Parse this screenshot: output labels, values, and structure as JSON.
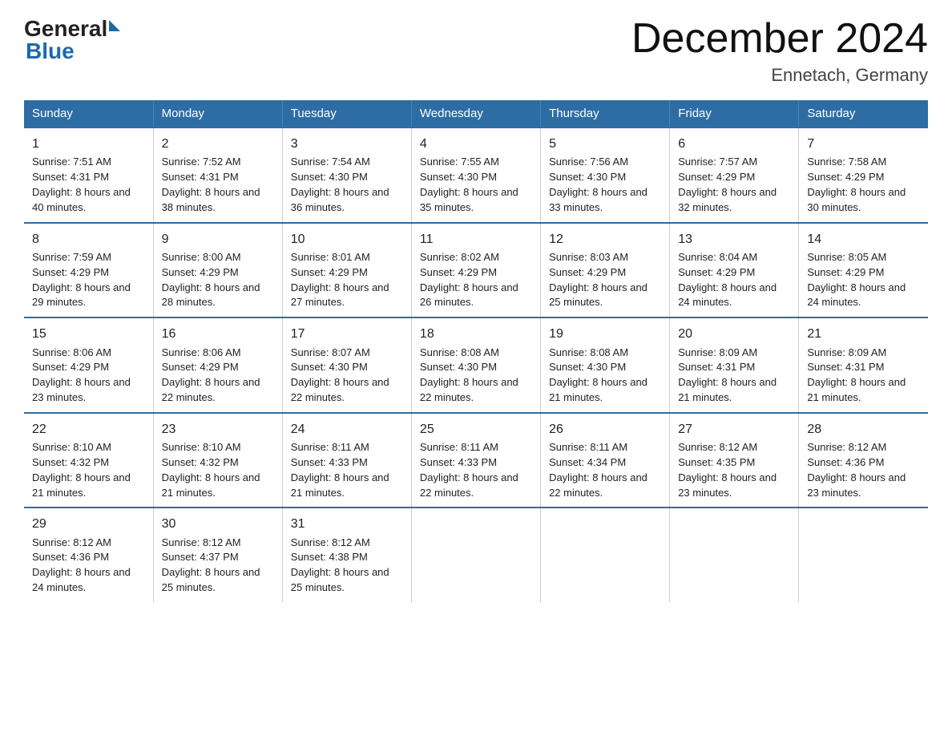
{
  "header": {
    "logo_general": "General",
    "logo_blue": "Blue",
    "title": "December 2024",
    "subtitle": "Ennetach, Germany"
  },
  "days_of_week": [
    "Sunday",
    "Monday",
    "Tuesday",
    "Wednesday",
    "Thursday",
    "Friday",
    "Saturday"
  ],
  "weeks": [
    [
      {
        "day": 1,
        "sunrise": "7:51 AM",
        "sunset": "4:31 PM",
        "daylight": "8 hours and 40 minutes."
      },
      {
        "day": 2,
        "sunrise": "7:52 AM",
        "sunset": "4:31 PM",
        "daylight": "8 hours and 38 minutes."
      },
      {
        "day": 3,
        "sunrise": "7:54 AM",
        "sunset": "4:30 PM",
        "daylight": "8 hours and 36 minutes."
      },
      {
        "day": 4,
        "sunrise": "7:55 AM",
        "sunset": "4:30 PM",
        "daylight": "8 hours and 35 minutes."
      },
      {
        "day": 5,
        "sunrise": "7:56 AM",
        "sunset": "4:30 PM",
        "daylight": "8 hours and 33 minutes."
      },
      {
        "day": 6,
        "sunrise": "7:57 AM",
        "sunset": "4:29 PM",
        "daylight": "8 hours and 32 minutes."
      },
      {
        "day": 7,
        "sunrise": "7:58 AM",
        "sunset": "4:29 PM",
        "daylight": "8 hours and 30 minutes."
      }
    ],
    [
      {
        "day": 8,
        "sunrise": "7:59 AM",
        "sunset": "4:29 PM",
        "daylight": "8 hours and 29 minutes."
      },
      {
        "day": 9,
        "sunrise": "8:00 AM",
        "sunset": "4:29 PM",
        "daylight": "8 hours and 28 minutes."
      },
      {
        "day": 10,
        "sunrise": "8:01 AM",
        "sunset": "4:29 PM",
        "daylight": "8 hours and 27 minutes."
      },
      {
        "day": 11,
        "sunrise": "8:02 AM",
        "sunset": "4:29 PM",
        "daylight": "8 hours and 26 minutes."
      },
      {
        "day": 12,
        "sunrise": "8:03 AM",
        "sunset": "4:29 PM",
        "daylight": "8 hours and 25 minutes."
      },
      {
        "day": 13,
        "sunrise": "8:04 AM",
        "sunset": "4:29 PM",
        "daylight": "8 hours and 24 minutes."
      },
      {
        "day": 14,
        "sunrise": "8:05 AM",
        "sunset": "4:29 PM",
        "daylight": "8 hours and 24 minutes."
      }
    ],
    [
      {
        "day": 15,
        "sunrise": "8:06 AM",
        "sunset": "4:29 PM",
        "daylight": "8 hours and 23 minutes."
      },
      {
        "day": 16,
        "sunrise": "8:06 AM",
        "sunset": "4:29 PM",
        "daylight": "8 hours and 22 minutes."
      },
      {
        "day": 17,
        "sunrise": "8:07 AM",
        "sunset": "4:30 PM",
        "daylight": "8 hours and 22 minutes."
      },
      {
        "day": 18,
        "sunrise": "8:08 AM",
        "sunset": "4:30 PM",
        "daylight": "8 hours and 22 minutes."
      },
      {
        "day": 19,
        "sunrise": "8:08 AM",
        "sunset": "4:30 PM",
        "daylight": "8 hours and 21 minutes."
      },
      {
        "day": 20,
        "sunrise": "8:09 AM",
        "sunset": "4:31 PM",
        "daylight": "8 hours and 21 minutes."
      },
      {
        "day": 21,
        "sunrise": "8:09 AM",
        "sunset": "4:31 PM",
        "daylight": "8 hours and 21 minutes."
      }
    ],
    [
      {
        "day": 22,
        "sunrise": "8:10 AM",
        "sunset": "4:32 PM",
        "daylight": "8 hours and 21 minutes."
      },
      {
        "day": 23,
        "sunrise": "8:10 AM",
        "sunset": "4:32 PM",
        "daylight": "8 hours and 21 minutes."
      },
      {
        "day": 24,
        "sunrise": "8:11 AM",
        "sunset": "4:33 PM",
        "daylight": "8 hours and 21 minutes."
      },
      {
        "day": 25,
        "sunrise": "8:11 AM",
        "sunset": "4:33 PM",
        "daylight": "8 hours and 22 minutes."
      },
      {
        "day": 26,
        "sunrise": "8:11 AM",
        "sunset": "4:34 PM",
        "daylight": "8 hours and 22 minutes."
      },
      {
        "day": 27,
        "sunrise": "8:12 AM",
        "sunset": "4:35 PM",
        "daylight": "8 hours and 23 minutes."
      },
      {
        "day": 28,
        "sunrise": "8:12 AM",
        "sunset": "4:36 PM",
        "daylight": "8 hours and 23 minutes."
      }
    ],
    [
      {
        "day": 29,
        "sunrise": "8:12 AM",
        "sunset": "4:36 PM",
        "daylight": "8 hours and 24 minutes."
      },
      {
        "day": 30,
        "sunrise": "8:12 AM",
        "sunset": "4:37 PM",
        "daylight": "8 hours and 25 minutes."
      },
      {
        "day": 31,
        "sunrise": "8:12 AM",
        "sunset": "4:38 PM",
        "daylight": "8 hours and 25 minutes."
      },
      null,
      null,
      null,
      null
    ]
  ]
}
